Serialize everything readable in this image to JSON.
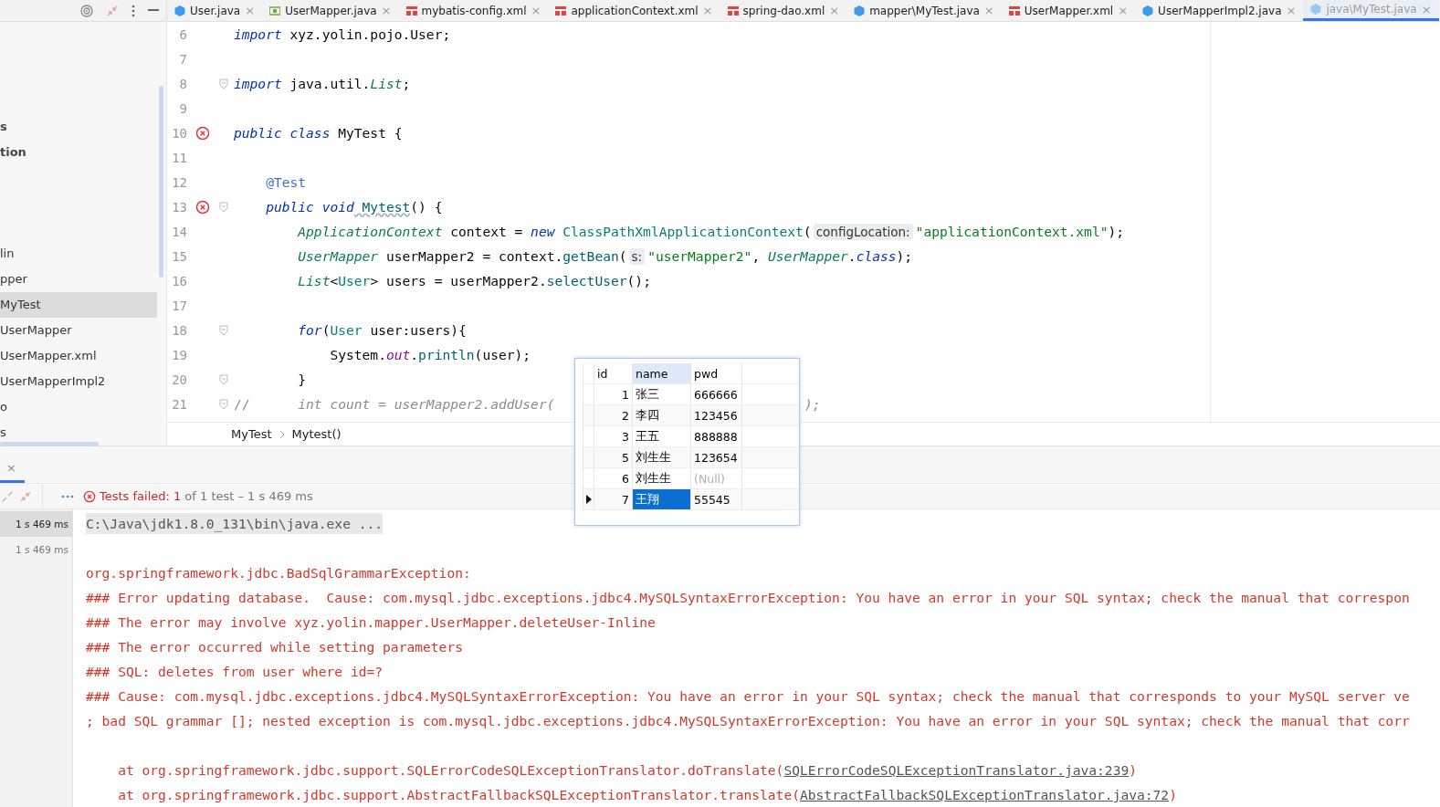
{
  "editor_tabs": [
    {
      "label": "User.java",
      "kind": "class",
      "close": "×",
      "selected": false
    },
    {
      "label": "UserMapper.java",
      "kind": "interface",
      "close": "×",
      "selected": false
    },
    {
      "label": "mybatis-config.xml",
      "kind": "xml",
      "close": "×",
      "selected": false
    },
    {
      "label": "applicationContext.xml",
      "kind": "xml",
      "close": "×",
      "selected": false
    },
    {
      "label": "spring-dao.xml",
      "kind": "xml",
      "close": "×",
      "selected": false
    },
    {
      "label": "mapper\\MyTest.java",
      "kind": "class",
      "close": "×",
      "selected": false
    },
    {
      "label": "UserMapper.xml",
      "kind": "xml",
      "close": "×",
      "selected": false
    },
    {
      "label": "UserMapperImpl2.java",
      "kind": "class",
      "close": "×",
      "selected": false
    },
    {
      "label": "java\\MyTest.java",
      "kind": "class",
      "close": "×",
      "selected": true
    }
  ],
  "project_tree": [
    {
      "label": "s",
      "bold": true,
      "selected": false
    },
    {
      "label": "tion",
      "bold": true,
      "selected": false
    },
    {
      "label": "lin",
      "bold": false,
      "selected": false
    },
    {
      "label": "pper",
      "bold": false,
      "selected": false
    },
    {
      "label": "MyTest",
      "bold": false,
      "selected": true
    },
    {
      "label": "UserMapper",
      "bold": false,
      "selected": false
    },
    {
      "label": "UserMapper.xml",
      "bold": false,
      "selected": false
    },
    {
      "label": "UserMapperImpl2",
      "bold": false,
      "selected": false
    },
    {
      "label": "o",
      "bold": false,
      "selected": false
    },
    {
      "label": "s",
      "bold": false,
      "selected": false
    }
  ],
  "code_lines": [
    {
      "number": "6",
      "error": false,
      "fold": false,
      "tokens": [
        {
          "text": "import",
          "kind": "keyword"
        },
        {
          "text": " xyz.yolin.pojo.User;",
          "kind": "plain"
        }
      ]
    },
    {
      "number": "7",
      "error": false,
      "fold": false
    },
    {
      "number": "8",
      "error": false,
      "fold": true,
      "tokens": [
        {
          "text": "import",
          "kind": "keyword"
        },
        {
          "text": " java.util.",
          "kind": "plain"
        },
        {
          "text": "List",
          "kind": "type"
        },
        {
          "text": ";",
          "kind": "plain"
        }
      ]
    },
    {
      "number": "9",
      "error": false,
      "fold": false
    },
    {
      "number": "10",
      "error": true,
      "fold": false,
      "tokens": [
        {
          "text": "public class",
          "kind": "keyword"
        },
        {
          "text": " MyTest {",
          "kind": "plain"
        }
      ]
    },
    {
      "number": "11",
      "error": false,
      "fold": false
    },
    {
      "number": "12",
      "error": false,
      "fold": false,
      "tokens": [
        {
          "text": "    @Test",
          "kind": "annotation"
        }
      ]
    },
    {
      "number": "13",
      "error": true,
      "fold": true,
      "tokens": [
        {
          "text": "    public void",
          "kind": "keyword"
        },
        {
          "text": " Mytest",
          "kind": "method-decl"
        },
        {
          "text": "() {",
          "kind": "plain"
        }
      ]
    },
    {
      "number": "14",
      "error": false,
      "fold": false,
      "tokens": [
        {
          "text": "        ApplicationContext",
          "kind": "type"
        },
        {
          "text": " context = ",
          "kind": "plain"
        },
        {
          "text": "new",
          "kind": "keyword"
        },
        {
          "text": " ClassPathXmlApplicationContext",
          "kind": "class"
        },
        {
          "text": "(",
          "kind": "plain"
        },
        {
          "text": "configLocation:",
          "kind": "hint"
        },
        {
          "text": "\"applicationContext.xml\"",
          "kind": "string"
        },
        {
          "text": ");",
          "kind": "plain"
        }
      ]
    },
    {
      "number": "15",
      "error": false,
      "fold": false,
      "tokens": [
        {
          "text": "        UserMapper",
          "kind": "type"
        },
        {
          "text": " userMapper2 = context.",
          "kind": "plain"
        },
        {
          "text": "getBean",
          "kind": "method"
        },
        {
          "text": "(",
          "kind": "plain"
        },
        {
          "text": "s:",
          "kind": "hint"
        },
        {
          "text": "\"userMapper2\"",
          "kind": "string"
        },
        {
          "text": ", ",
          "kind": "plain"
        },
        {
          "text": "UserMapper",
          "kind": "type"
        },
        {
          "text": ".",
          "kind": "plain"
        },
        {
          "text": "class",
          "kind": "keyword"
        },
        {
          "text": ");",
          "kind": "plain"
        }
      ]
    },
    {
      "number": "16",
      "error": false,
      "fold": false,
      "tokens": [
        {
          "text": "        List",
          "kind": "type"
        },
        {
          "text": "<",
          "kind": "plain"
        },
        {
          "text": "User",
          "kind": "class"
        },
        {
          "text": "> users = userMapper2.",
          "kind": "plain"
        },
        {
          "text": "selectUser",
          "kind": "method"
        },
        {
          "text": "();",
          "kind": "plain"
        }
      ]
    },
    {
      "number": "17",
      "error": false,
      "fold": false
    },
    {
      "number": "18",
      "error": false,
      "fold": true,
      "tokens": [
        {
          "text": "        for",
          "kind": "keyword"
        },
        {
          "text": "(",
          "kind": "plain"
        },
        {
          "text": "User",
          "kind": "class"
        },
        {
          "text": " user:users){",
          "kind": "plain"
        }
      ]
    },
    {
      "number": "19",
      "error": false,
      "fold": false,
      "tokens": [
        {
          "text": "            System.",
          "kind": "plain"
        },
        {
          "text": "out",
          "kind": "static"
        },
        {
          "text": ".",
          "kind": "plain"
        },
        {
          "text": "println",
          "kind": "method"
        },
        {
          "text": "(user);",
          "kind": "plain"
        }
      ]
    },
    {
      "number": "20",
      "error": false,
      "fold": true,
      "tokens": [
        {
          "text": "        }",
          "kind": "plain"
        }
      ]
    },
    {
      "number": "21",
      "error": false,
      "fold": true,
      "tokens": [
        {
          "text": "//",
          "kind": "comment"
        },
        {
          "text": "      int count = userMapper2.addUser(",
          "kind": "comment-italic"
        },
        {
          "text": ");",
          "kind": "comment-tail"
        }
      ]
    }
  ],
  "breadcrumb": [
    "MyTest",
    "Mytest()"
  ],
  "result_grid": {
    "columns": [
      "id",
      "name",
      "pwd"
    ],
    "rows": [
      {
        "id": "1",
        "name": "张三",
        "pwd": "666666",
        "null": false,
        "selected": false
      },
      {
        "id": "2",
        "name": "李四",
        "pwd": "123456",
        "null": false,
        "selected": false
      },
      {
        "id": "3",
        "name": "王五",
        "pwd": "888888",
        "null": false,
        "selected": false
      },
      {
        "id": "5",
        "name": "刘生生",
        "pwd": "123654",
        "null": false,
        "selected": false
      },
      {
        "id": "6",
        "name": "刘生生",
        "pwd": "(Null)",
        "null": true,
        "selected": false
      },
      {
        "id": "7",
        "name": "王翔",
        "pwd": "55545",
        "null": false,
        "selected": true
      }
    ]
  },
  "panel_tab": {
    "close": "×"
  },
  "test_status": {
    "failed": "Tests failed: 1",
    "detail": "of 1 test – 1 s 469 ms"
  },
  "test_tree": [
    {
      "time": "1 s 469 ms",
      "selected": true
    },
    {
      "time": "1 s 469 ms",
      "selected": false
    }
  ],
  "console": [
    {
      "kind": "command",
      "text": "C:\\Java\\jdk1.8.0_131\\bin\\java.exe ..."
    },
    {
      "kind": "blank"
    },
    {
      "kind": "error",
      "text": "org.springframework.jdbc.BadSqlGrammarException: "
    },
    {
      "kind": "error",
      "text": "### Error updating database.  Cause: com.mysql.jdbc.exceptions.jdbc4.MySQLSyntaxErrorException: You have an error in your SQL syntax; check the manual that correspon"
    },
    {
      "kind": "error",
      "text": "### The error may involve xyz.yolin.mapper.UserMapper.deleteUser-Inline"
    },
    {
      "kind": "error",
      "text": "### The error occurred while setting parameters"
    },
    {
      "kind": "error",
      "text": "### SQL: deletes from user where id=?"
    },
    {
      "kind": "error",
      "text": "### Cause: com.mysql.jdbc.exceptions.jdbc4.MySQLSyntaxErrorException: You have an error in your SQL syntax; check the manual that corresponds to your MySQL server ve"
    },
    {
      "kind": "error",
      "text": "; bad SQL grammar []; nested exception is com.mysql.jdbc.exceptions.jdbc4.MySQLSyntaxErrorException: You have an error in your SQL syntax; check the manual that corr"
    },
    {
      "kind": "blank"
    },
    {
      "kind": "trace",
      "text": "    at org.springframework.jdbc.support.SQLErrorCodeSQLExceptionTranslator.doTranslate(",
      "link": "SQLErrorCodeSQLExceptionTranslator.java:239",
      "tail": ")"
    },
    {
      "kind": "trace",
      "text": "    at org.springframework.jdbc.support.AbstractFallbackSQLExceptionTranslator.translate(",
      "link": "AbstractFallbackSQLExceptionTranslator.java:72",
      "tail": ")"
    }
  ]
}
